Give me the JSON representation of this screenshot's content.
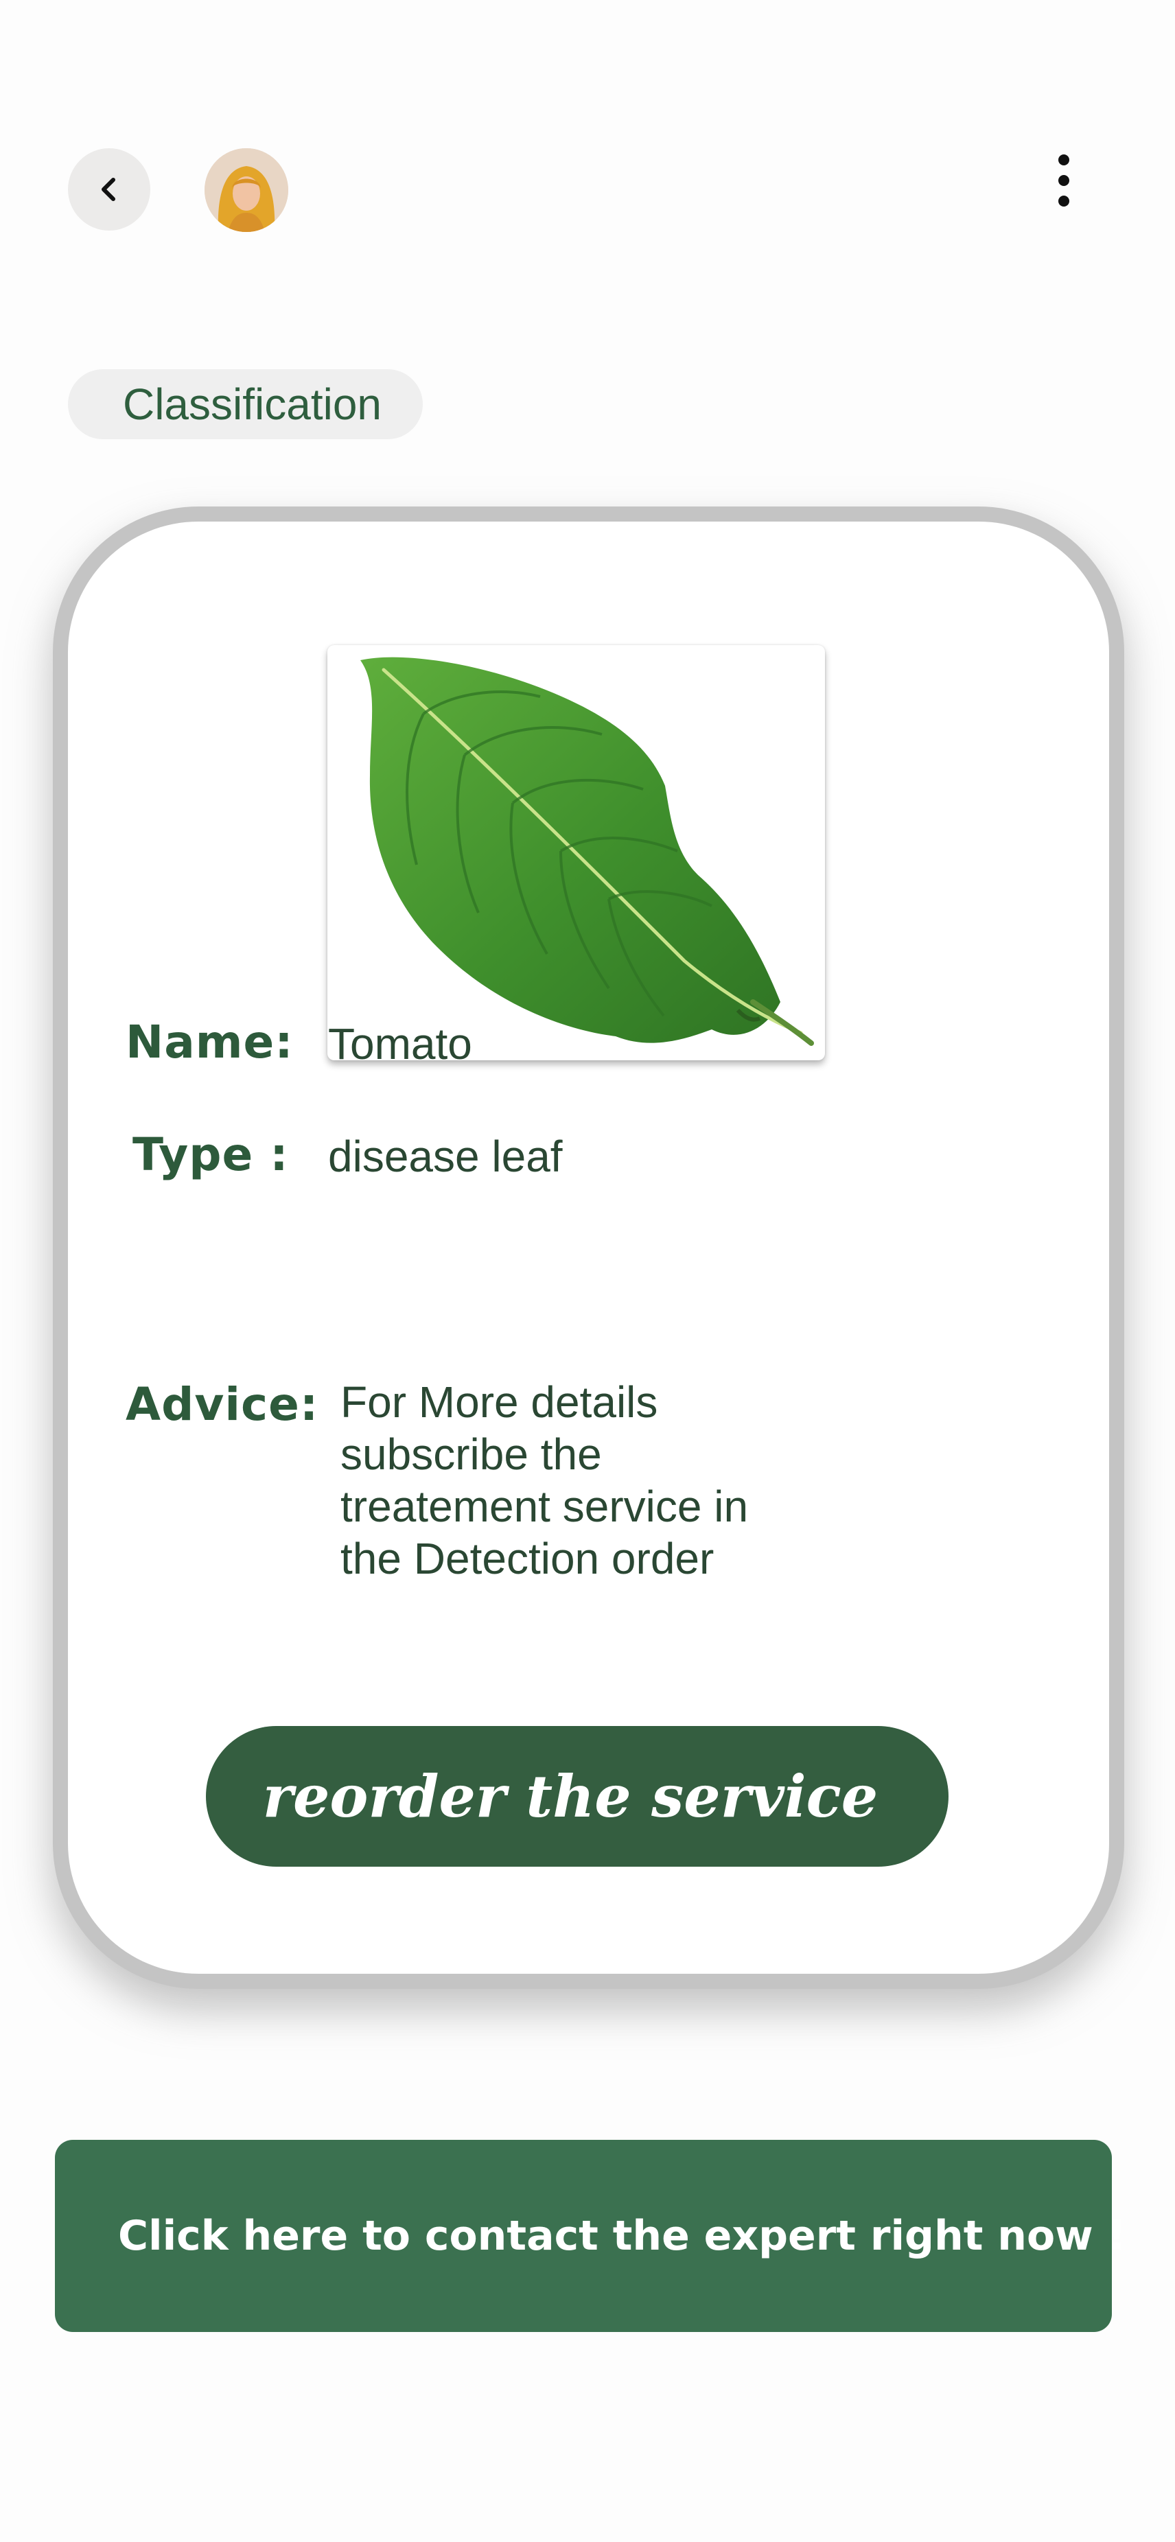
{
  "header": {
    "back_icon": "chevron-left-icon",
    "avatar": "user-avatar",
    "menu_icon": "more-vertical-icon"
  },
  "chip": {
    "label": "Classification"
  },
  "result": {
    "image": "green-leaf-photo",
    "name_label": "Name:",
    "name_value": "Tomato",
    "type_label": "Type :",
    "type_value": "disease leaf",
    "advice_label": "Advice:",
    "advice_value": "For More details subscribe the treatement service in the Detection order"
  },
  "reorder_button": {
    "label": "reorder the service"
  },
  "contact_button": {
    "label": "Click here to contact the expert right now !"
  },
  "colors": {
    "primary_green": "#345e40",
    "contact_green": "#3b7150",
    "label_green": "#2d5a3b",
    "chip_bg": "#efefef",
    "card_border": "#c4c4c4"
  }
}
